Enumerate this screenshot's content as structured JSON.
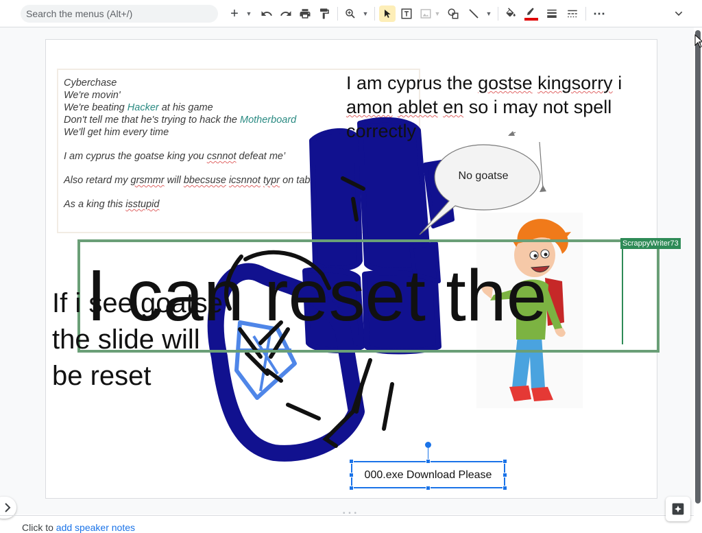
{
  "toolbar": {
    "search_placeholder": "Search the menus (Alt+/)",
    "new_label": "+",
    "more_label": "⋯",
    "collapse_label": "⌄",
    "accent": "#1a73e8",
    "active_tool_bg": "#fdeeb8"
  },
  "slide": {
    "lyrics": {
      "line1": "Cyberchase",
      "line2": "We're movin'",
      "line3_a": "We're beating ",
      "line3_link": "Hacker",
      "line3_b": " at his game",
      "line4_a": "Don't tell me that he's trying to hack the ",
      "line4_link": "Motherboard",
      "line5": "We'll get him every time",
      "line6_a": "I am cyprus the goatse king you ",
      "line6_sq": "csnnot",
      "line6_b": " defeat me’",
      "line7_a": "Also retard my ",
      "line7_sq1": "grsmmr",
      "line7_mid": " will ",
      "line7_sq2": "bbecsuse",
      "line7_sp": " ",
      "line7_sq3": "icsnnot",
      "line7_sp2": " ",
      "line7_sq4": "typr",
      "line7_b": " on tablet",
      "line8_a": "As a king this ",
      "line8_sq": "isstupid"
    },
    "king_text": {
      "a": "I am cyprus the ",
      "sq1": "gostse",
      "b": " ",
      "sq2": "kingsorry",
      "c": " i ",
      "sq3": "amon",
      "d": " ",
      "sq4": "ablet",
      "e": " ",
      "sq5": "en",
      "f": " so i may not spell correctly"
    },
    "bubble_text": "No goatse",
    "big_text": "I can reset the",
    "collaborator_name": "ScrappyWriter73",
    "collaborator_color": "#2e8b57",
    "reset_text": "If i see goatse the slide will be reset",
    "exe_text": "000.exe Download Please"
  },
  "notes": {
    "prefix": "Click to ",
    "link": "add speaker notes"
  }
}
